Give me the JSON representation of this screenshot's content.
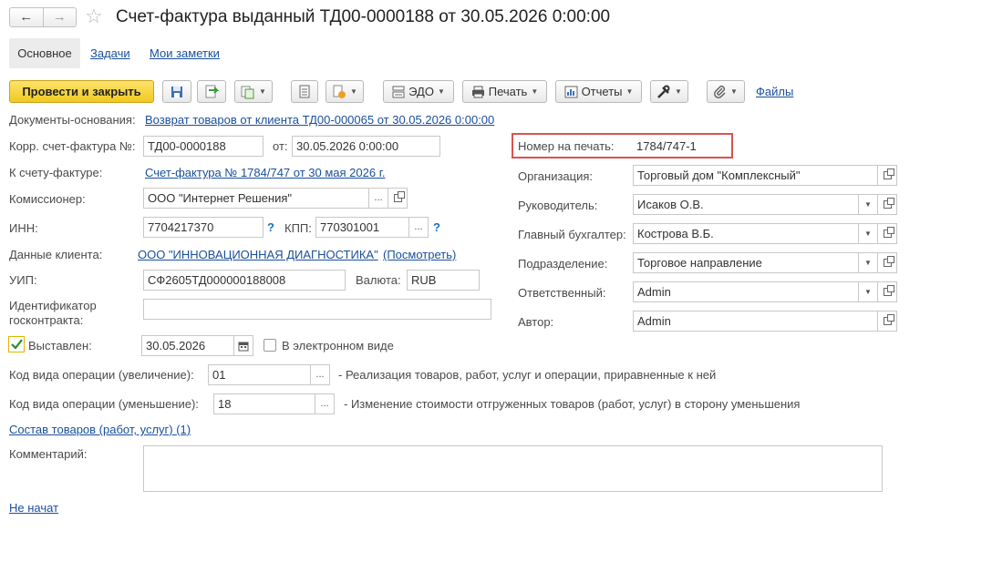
{
  "window": {
    "title": "Счет-фактура выданный ТД00-0000188 от 30.05.2026 0:00:00",
    "back_glyph": "←",
    "forward_glyph": "→",
    "star_glyph": "☆"
  },
  "tabs": [
    {
      "label": "Основное",
      "active": true
    },
    {
      "label": "Задачи",
      "active": false
    },
    {
      "label": "Мои заметки",
      "active": false
    }
  ],
  "toolbar": {
    "post_close_label": "Провести и закрыть",
    "edo_label": "ЭДО",
    "print_label": "Печать",
    "reports_label": "Отчеты",
    "files_label": "Файлы",
    "accent_color": "#f7d433"
  },
  "form": {
    "base_docs_label": "Документы-основания:",
    "base_docs_link": "Возврат товаров от клиента ТД00-000065 от 30.05.2026 0:00:00",
    "corr_invoice_label": "Корр. счет-фактура №:",
    "corr_invoice_value": "ТД00-0000188",
    "from_label": "от:",
    "from_value": "30.05.2026  0:00:00",
    "to_invoice_label": "К счету-фактуре:",
    "to_invoice_link": "Счет-фактура № 1784/747 от 30 мая 2026 г.",
    "commissioner_label": "Комиссионер:",
    "commissioner_value": "ООО \"Интернет Решения\"",
    "inn_label": "ИНН:",
    "inn_value": "7704217370",
    "kpp_label": "КПП:",
    "kpp_value": "770301001",
    "client_data_label": "Данные клиента:",
    "client_link": "ООО \"ИННОВАЦИОННАЯ ДИАГНОСТИКА\"",
    "view_link": "(Посмотреть)",
    "uip_label": "УИП:",
    "uip_value": "СФ2605ТД000000188008",
    "currency_label": "Валюта:",
    "currency_value": "RUB",
    "contract_id_label_1": "Идентификатор",
    "contract_id_label_2": "госконтракта:",
    "contract_id_value": "",
    "issued_label": "Выставлен:",
    "issued_checked": true,
    "issued_date": "30.05.2026",
    "electronic_label": "В электронном виде",
    "op_inc_label": "Код вида операции (увеличение):",
    "op_inc_value": "01",
    "op_inc_desc": "- Реализация товаров, работ, услуг и операции, приравненные к ней",
    "op_dec_label": "Код вида операции (уменьшение):",
    "op_dec_value": "18",
    "op_dec_desc": "- Изменение стоимости отгруженных товаров (работ, услуг) в сторону уменьшения",
    "goods_link": "Состав товаров (работ, услуг) (1)",
    "comment_label": "Комментарий:",
    "comment_value": "",
    "status_link": "Не начат"
  },
  "right": {
    "print_number_label": "Номер на печать:",
    "print_number_value": "1784/747-1",
    "highlight_color": "#d9534f",
    "org_label": "Организация:",
    "org_value": "Торговый дом \"Комплексный\"",
    "head_label": "Руководитель:",
    "head_value": "Исаков О.В.",
    "accountant_label": "Главный бухгалтер:",
    "accountant_value": "Кострова В.Б.",
    "division_label": "Подразделение:",
    "division_value": "Торговое направление",
    "responsible_label": "Ответственный:",
    "responsible_value": "Admin",
    "author_label": "Автор:",
    "author_value": "Admin"
  }
}
